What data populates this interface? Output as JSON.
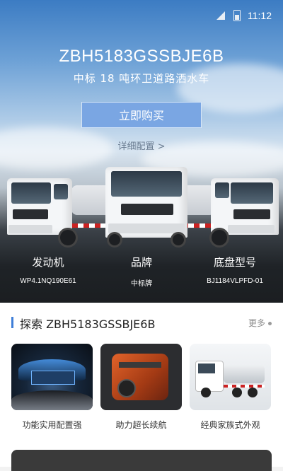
{
  "status_bar": {
    "time": "11:12"
  },
  "hero": {
    "title": "ZBH5183GSSBJE6B",
    "subtitle": "中标 18 吨环卫道路洒水车",
    "buy_button": "立即购买",
    "detail_link": "详细配置 >",
    "specs": [
      {
        "label": "发动机",
        "value": "WP4.1NQ190E61"
      },
      {
        "label": "品牌",
        "value": "中标牌"
      },
      {
        "label": "底盘型号",
        "value": "BJ1184VLPFD-01"
      }
    ]
  },
  "explore": {
    "title": "探索 ZBH5183GSSBJE6B",
    "more": "更多",
    "cards": [
      {
        "caption": "功能实用配置强",
        "icon": "dashboard-image"
      },
      {
        "caption": "助力超长续航",
        "icon": "engine-image"
      },
      {
        "caption": "经典家族式外观",
        "icon": "truck-image"
      }
    ]
  },
  "colors": {
    "accent": "#3f7fd8",
    "button": "#7aa6e3"
  }
}
